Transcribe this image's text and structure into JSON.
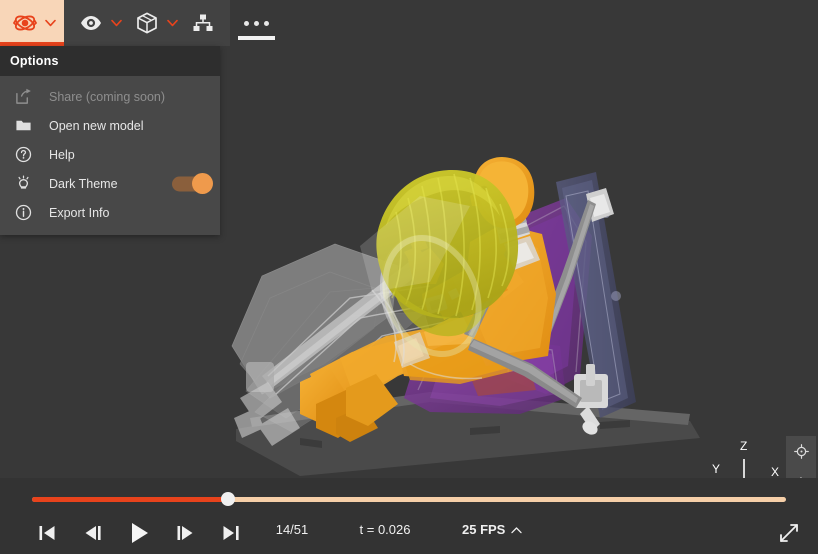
{
  "toolbar": {
    "orbit_tool": {
      "icon": "orbit-rotate-icon",
      "active": true
    },
    "visibility_tool": {
      "icon": "eye-icon"
    },
    "parts_tool": {
      "icon": "cube-icon"
    },
    "tree_tool": {
      "icon": "hierarchy-tree-icon"
    },
    "more_tool": {
      "icon": "ellipsis-icon",
      "active": true
    },
    "chevron": "chevron-down-icon"
  },
  "options_menu": {
    "title": "Options",
    "items": [
      {
        "label": "Share (coming soon)",
        "icon": "share-icon",
        "disabled": true,
        "has_toggle": false
      },
      {
        "label": "Open new model",
        "icon": "folder-icon",
        "disabled": false,
        "has_toggle": false
      },
      {
        "label": "Help",
        "icon": "question-circle-icon",
        "disabled": false,
        "has_toggle": false
      },
      {
        "label": "Dark Theme",
        "icon": "lightbulb-icon",
        "disabled": false,
        "has_toggle": true,
        "toggle_on": true
      },
      {
        "label": "Export Info",
        "icon": "info-circle-icon",
        "disabled": false,
        "has_toggle": false
      }
    ]
  },
  "viewport": {
    "scene_description": "crash-test-dummy-seat-airbag-simulation",
    "background_color": "#383838",
    "axis_triad": {
      "x_label": "X",
      "y_label": "Y",
      "z_label": "Z"
    },
    "zoom_controls": {
      "fit_icon": "crosshair-target-icon",
      "zoom_in_label": "+",
      "zoom_out_label": "−"
    }
  },
  "playback": {
    "seek_position_percent": 26,
    "fill_color": "#e8431c",
    "track_color": "#f6cfa8",
    "buttons": [
      {
        "name": "skip-to-start-button",
        "icon": "skip-start-icon"
      },
      {
        "name": "step-backward-button",
        "icon": "step-back-icon"
      },
      {
        "name": "play-button",
        "icon": "play-icon"
      },
      {
        "name": "step-forward-button",
        "icon": "step-forward-icon"
      },
      {
        "name": "skip-to-end-button",
        "icon": "skip-end-icon"
      }
    ],
    "frame_counter": "14/51",
    "time_readout": "t = 0.026",
    "fps_label": "25 FPS",
    "fps_chevron": "chevron-up-icon",
    "fullscreen_icon": "expand-diagonal-icon"
  }
}
